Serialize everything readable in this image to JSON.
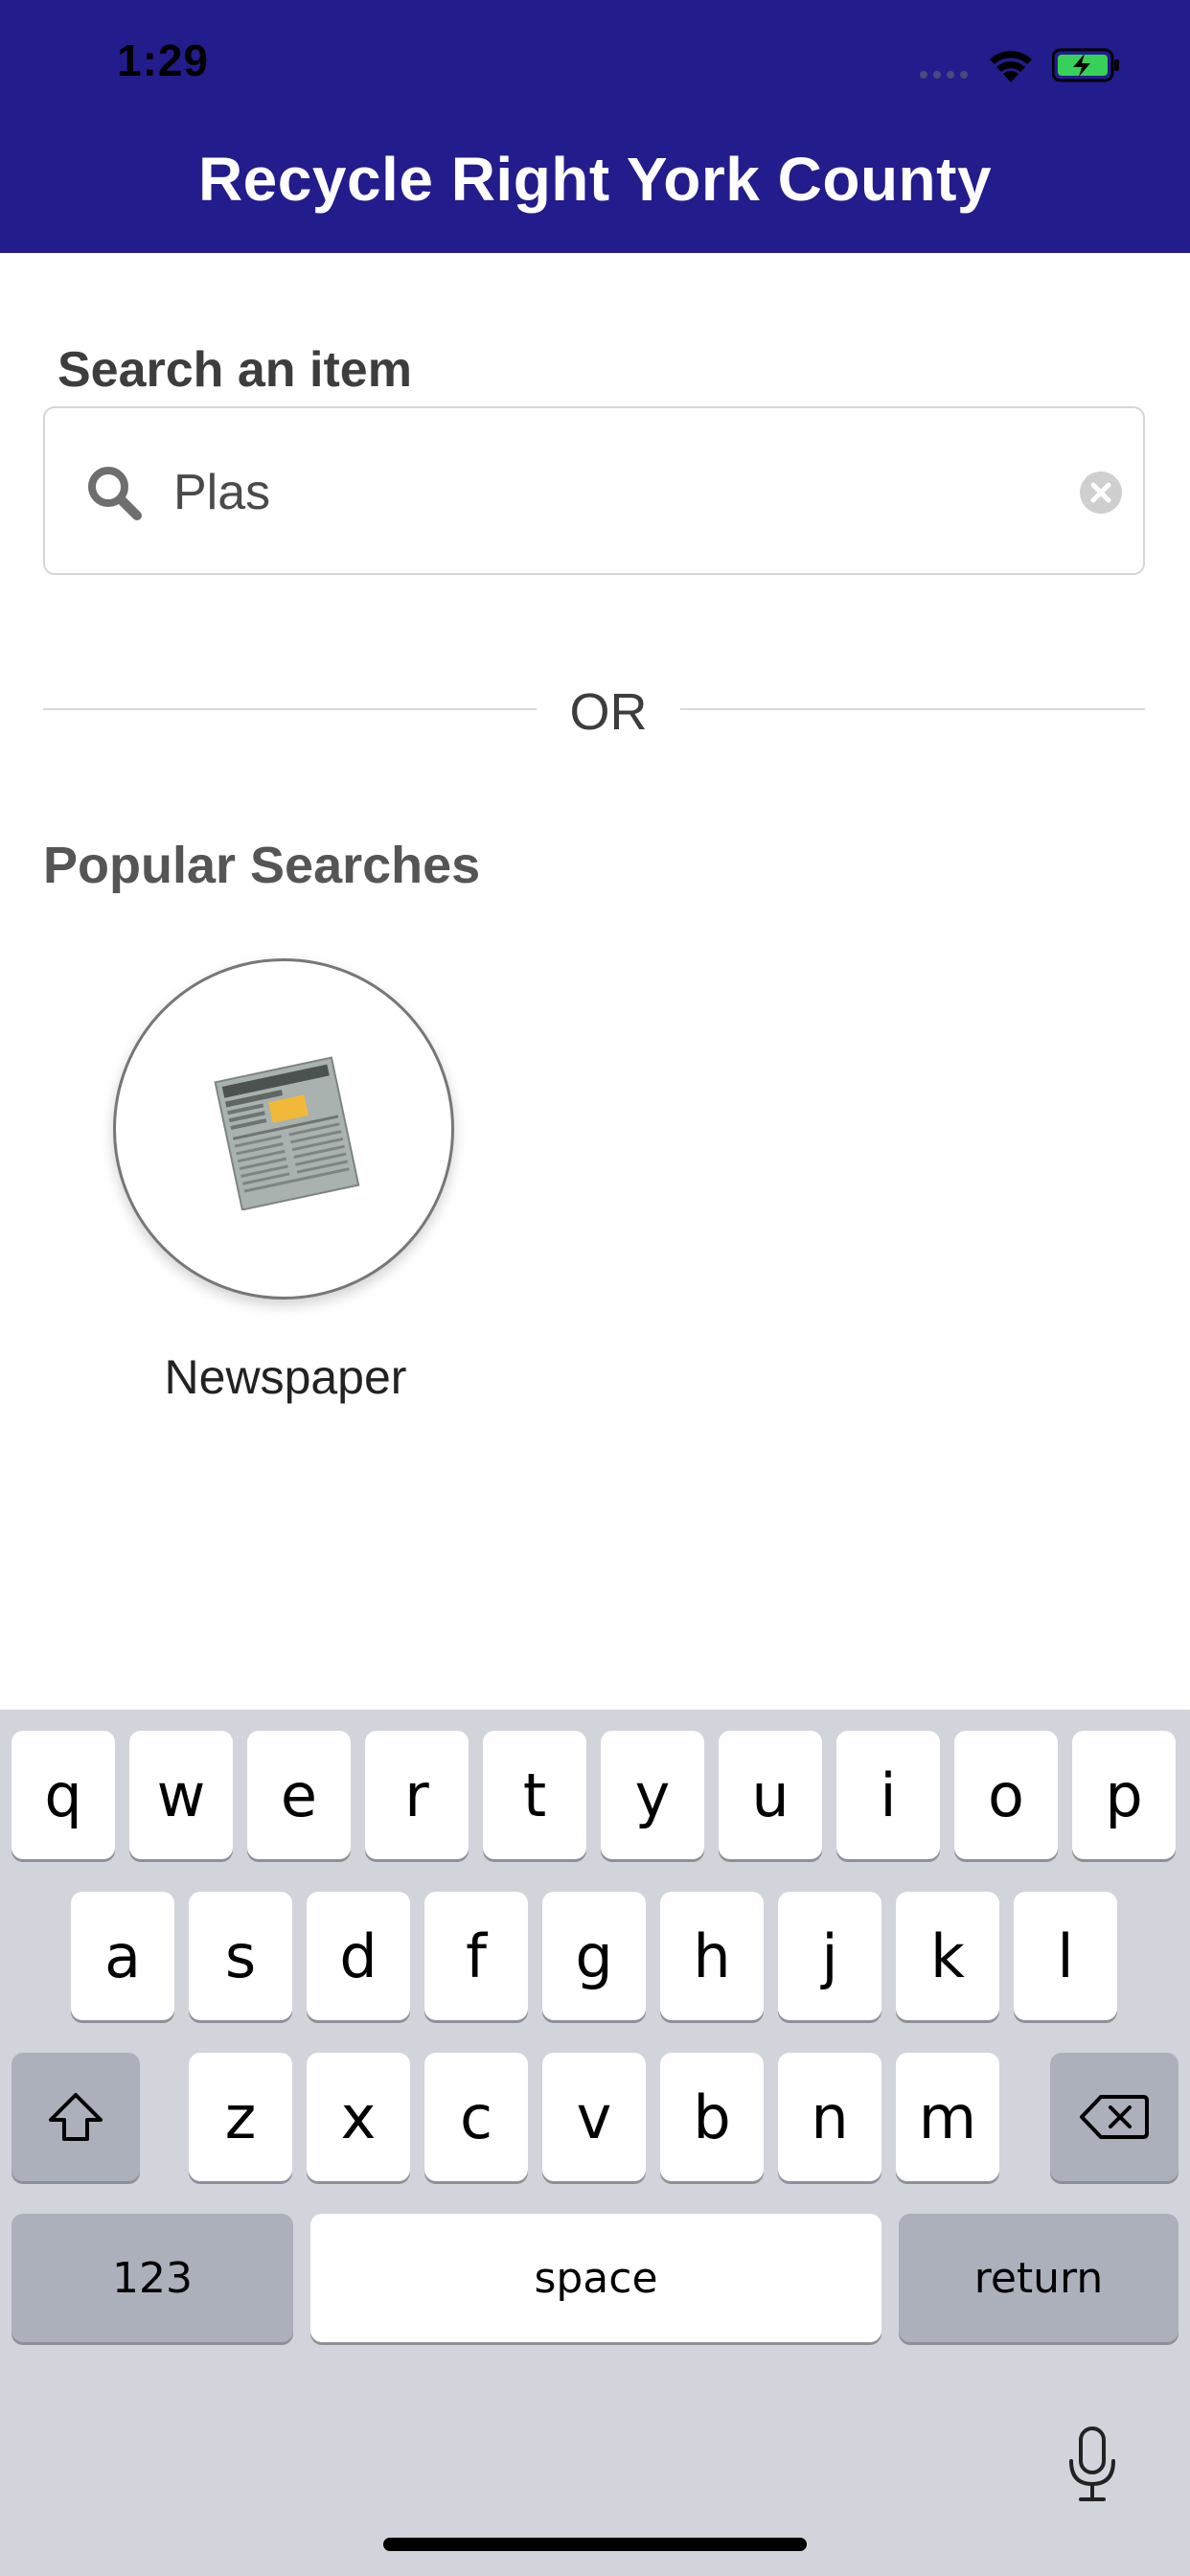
{
  "status_bar": {
    "time": "1:29",
    "wifi_icon": "wifi-icon",
    "battery_icon": "battery-charging-icon"
  },
  "header": {
    "title": "Recycle Right York County",
    "background_color": "#231c8c"
  },
  "search": {
    "label": "Search an item",
    "value": "Plas",
    "search_icon": "search-icon",
    "clear_icon": "clear-icon"
  },
  "divider": {
    "text": "OR"
  },
  "popular": {
    "title": "Popular Searches",
    "items": [
      {
        "label": "Newspaper",
        "icon": "newspaper-icon"
      }
    ]
  },
  "keyboard": {
    "row1": [
      "q",
      "w",
      "e",
      "r",
      "t",
      "y",
      "u",
      "i",
      "o",
      "p"
    ],
    "row2": [
      "a",
      "s",
      "d",
      "f",
      "g",
      "h",
      "j",
      "k",
      "l"
    ],
    "row3": [
      "z",
      "x",
      "c",
      "v",
      "b",
      "n",
      "m"
    ],
    "shift_icon": "shift-icon",
    "backspace_icon": "backspace-icon",
    "numbers_label": "123",
    "space_label": "space",
    "return_label": "return",
    "mic_icon": "microphone-icon"
  }
}
